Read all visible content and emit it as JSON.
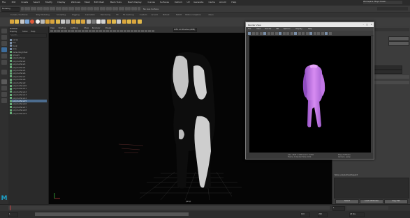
{
  "menubar": {
    "items": [
      "File",
      "Edit",
      "Create",
      "Select",
      "Modify",
      "Display",
      "Windows",
      "Mesh",
      "Edit Mesh",
      "Mesh Tools",
      "Mesh Display",
      "Curves",
      "Surfaces",
      "Deform",
      "UV",
      "Generate",
      "Cache",
      "Arnold",
      "Help"
    ],
    "workspace_label": "Workspace: Maya Classic"
  },
  "modebar": {
    "mode_value": "Modeling",
    "live_label": "No Live Surface"
  },
  "shelf_tabs": [
    "Curves / Surfaces",
    "Poly Modeling",
    "Sculpting",
    "Rigging",
    "Animation",
    "Rendering",
    "FX",
    "FX Caching",
    "Custom",
    "Arnold",
    "Bifrost",
    "MASH",
    "Motion Graphics",
    "XGen"
  ],
  "outliner": {
    "menu": [
      "Display",
      "Show",
      "Help"
    ],
    "search_placeholder": "Search...",
    "rows": [
      {
        "label": "persp",
        "selected": false
      },
      {
        "label": "top",
        "selected": false
      },
      {
        "label": "front",
        "selected": false
      },
      {
        "label": "side",
        "selected": false
      },
      {
        "label": "defaultLightSet",
        "selected": false
      },
      {
        "label": "group1",
        "selected": false
      },
      {
        "label": "polySurface1",
        "selected": false
      },
      {
        "label": "polySurface2",
        "selected": false
      },
      {
        "label": "polySurface3",
        "selected": false
      },
      {
        "label": "polySurface4",
        "selected": false
      },
      {
        "label": "polySurface5",
        "selected": false
      },
      {
        "label": "polySurface6",
        "selected": false
      },
      {
        "label": "polySurface7",
        "selected": false
      },
      {
        "label": "polySurface8",
        "selected": false
      },
      {
        "label": "polySurface9",
        "selected": false
      },
      {
        "label": "polySurface10",
        "selected": false
      },
      {
        "label": "polySurface11",
        "selected": false
      },
      {
        "label": "polySurface12",
        "selected": false
      },
      {
        "label": "polySurface13",
        "selected": false
      },
      {
        "label": "polySurface14",
        "selected": false
      },
      {
        "label": "polySurface15",
        "selected": true
      },
      {
        "label": "polySurface16",
        "selected": false
      },
      {
        "label": "polySurface17",
        "selected": false
      },
      {
        "label": "polySurface18",
        "selected": false
      },
      {
        "label": "polySurface19",
        "selected": false
      }
    ]
  },
  "viewport": {
    "menu": [
      "View",
      "Shading",
      "Lighting",
      "Show",
      "Renderer",
      "Panels"
    ],
    "camera_label": "persp",
    "color_space": "ACES 1.0 SDR-video (sRGB)"
  },
  "render_view": {
    "title": "Render View",
    "menu": [
      "File",
      "View",
      "Render",
      "IPR",
      "Options",
      "Display",
      "Help"
    ],
    "status_line1": "size: 1920 x 1080  zoom: 0.082",
    "status_line2": "Frame: 1    Render Time: 0:02",
    "status_right1": "Maya Software",
    "status_right2": "Camera: persp"
  },
  "right_panel": {
    "node_label": "...",
    "buttons": [
      "Select",
      "Load Attributes",
      "Copy Tab"
    ],
    "tab_label": "",
    "notes_label": "Notes: polySurfaceShape15"
  },
  "timeline": {
    "start": "1",
    "end": "120",
    "range_start": "1",
    "range_end": "120",
    "playback_end": "200",
    "fps": "24 fps"
  },
  "colors": {
    "render_cloth": "#b46bdc",
    "cloth_highlight": "#e08ef5",
    "selection": "#4c6c8e",
    "maya_logo": "#1ea1c8"
  }
}
